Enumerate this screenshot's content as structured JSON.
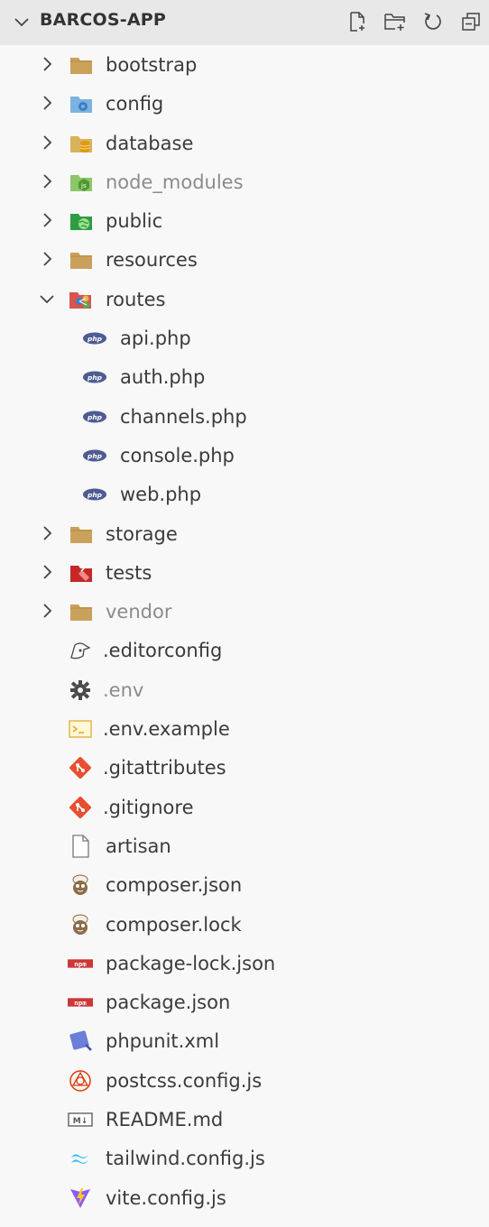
{
  "explorer": {
    "title": "BARCOS-APP",
    "actions": [
      {
        "name": "new-file-icon"
      },
      {
        "name": "new-folder-icon"
      },
      {
        "name": "refresh-icon"
      },
      {
        "name": "collapse-all-icon"
      }
    ]
  },
  "folders_top": [
    {
      "label": "bootstrap",
      "icon": "folder-icon",
      "color": "#c9a15a",
      "dim": false
    },
    {
      "label": "config",
      "icon": "folder-config-icon",
      "color": "#4f9fd8",
      "dim": false
    },
    {
      "label": "database",
      "icon": "folder-database-icon",
      "color": "#e0a526",
      "dim": false
    },
    {
      "label": "node_modules",
      "icon": "folder-node-icon",
      "color": "#6fb545",
      "dim": true
    },
    {
      "label": "public",
      "icon": "folder-public-icon",
      "color": "#3aa64a",
      "dim": false
    },
    {
      "label": "resources",
      "icon": "folder-icon",
      "color": "#c9a15a",
      "dim": false
    }
  ],
  "routes": {
    "label": "routes",
    "icon": "folder-routes-icon",
    "files": [
      "api.php",
      "auth.php",
      "channels.php",
      "console.php",
      "web.php"
    ]
  },
  "folders_bottom": [
    {
      "label": "storage",
      "icon": "folder-icon",
      "color": "#c9a15a",
      "dim": false
    },
    {
      "label": "tests",
      "icon": "folder-tests-icon",
      "color": "#d23c3c",
      "dim": false
    },
    {
      "label": "vendor",
      "icon": "folder-icon",
      "color": "#c9a15a",
      "dim": true
    }
  ],
  "files": [
    {
      "label": ".editorconfig",
      "icon": "editorconfig-icon",
      "dim": false
    },
    {
      "label": ".env",
      "icon": "gear-icon",
      "dim": true
    },
    {
      "label": ".env.example",
      "icon": "terminal-icon",
      "dim": false
    },
    {
      "label": ".gitattributes",
      "icon": "git-icon",
      "dim": false
    },
    {
      "label": ".gitignore",
      "icon": "git-icon",
      "dim": false
    },
    {
      "label": "artisan",
      "icon": "blank-file-icon",
      "dim": false
    },
    {
      "label": "composer.json",
      "icon": "composer-icon",
      "dim": false
    },
    {
      "label": "composer.lock",
      "icon": "composer-icon",
      "dim": false
    },
    {
      "label": "package-lock.json",
      "icon": "npm-icon",
      "dim": false
    },
    {
      "label": "package.json",
      "icon": "npm-icon",
      "dim": false
    },
    {
      "label": "phpunit.xml",
      "icon": "phpunit-icon",
      "dim": false
    },
    {
      "label": "postcss.config.js",
      "icon": "postcss-icon",
      "dim": false
    },
    {
      "label": "README.md",
      "icon": "markdown-icon",
      "dim": false
    },
    {
      "label": "tailwind.config.js",
      "icon": "tailwind-icon",
      "dim": false
    },
    {
      "label": "vite.config.js",
      "icon": "vite-icon",
      "dim": false
    }
  ]
}
